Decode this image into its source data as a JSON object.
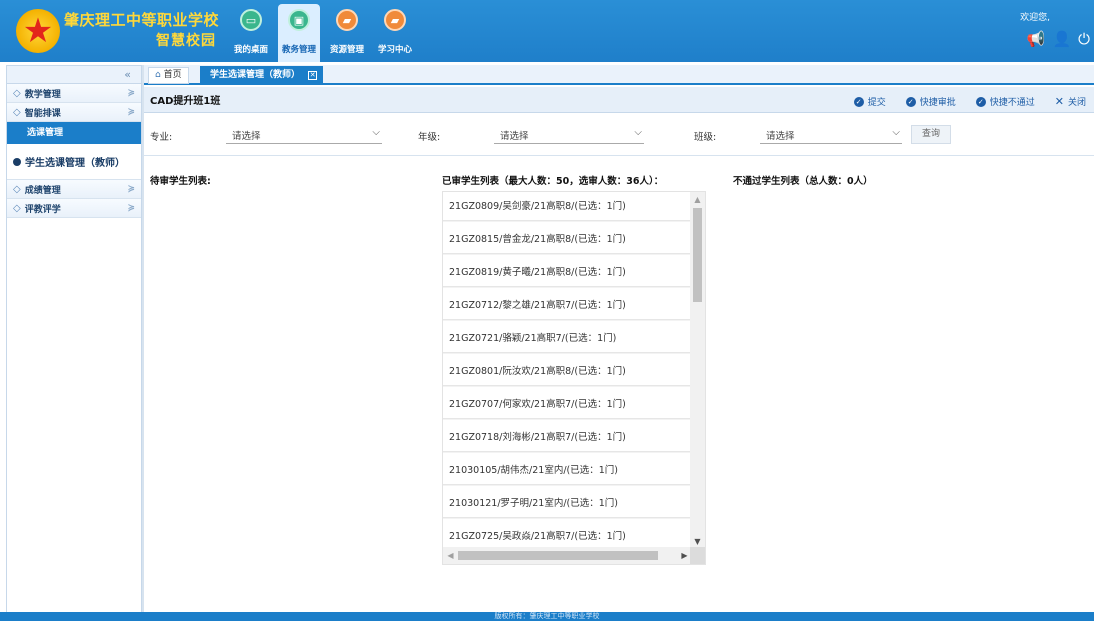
{
  "header": {
    "school_name": "肇庆理工中等职业学校",
    "campus_name": "智慧校园",
    "welcome": "欢迎您,",
    "nav": [
      {
        "label": "我的桌面",
        "icon": "desktop-icon",
        "active": false
      },
      {
        "label": "教务管理",
        "icon": "academic-icon",
        "active": true
      },
      {
        "label": "资源管理",
        "icon": "folder-icon",
        "active": false
      },
      {
        "label": "学习中心",
        "icon": "folder-icon",
        "active": false
      }
    ]
  },
  "sidebar": {
    "groups": [
      {
        "label": "教学管理"
      },
      {
        "label": "智能排课"
      }
    ],
    "sub_active": "选课管理",
    "leaf": "学生选课管理（教师）",
    "groups_after": [
      {
        "label": "成绩管理"
      },
      {
        "label": "评教评学"
      }
    ]
  },
  "tabs": {
    "home": "首页",
    "active": "学生选课管理（教师）"
  },
  "page": {
    "title": "CAD提升班1班",
    "actions": {
      "submit": "提交",
      "quick_approve": "快捷审批",
      "quick_reject": "快捷不通过",
      "close": "关闭"
    }
  },
  "filters": {
    "major_label": "专业:",
    "major_value": "请选择",
    "grade_label": "年级:",
    "grade_value": "请选择",
    "class_label": "班级:",
    "class_value": "请选择",
    "query": "查询"
  },
  "columns": {
    "pending": "待审学生列表:",
    "approved": "已审学生列表（最大人数：50，选审人数：36人）：",
    "rejected": "不通过学生列表（总人数：0人）"
  },
  "approved_list": [
    "21GZ0809/吴剑豪/21高职8/(已选：1门)",
    "21GZ0815/曾金龙/21高职8/(已选：1门)",
    "21GZ0819/黄子曦/21高职8/(已选：1门)",
    "21GZ0712/黎之雄/21高职7/(已选：1门)",
    "21GZ0721/骆颖/21高职7/(已选：1门)",
    "21GZ0801/阮汝欢/21高职8/(已选：1门)",
    "21GZ0707/何家欢/21高职7/(已选：1门)",
    "21GZ0718/刘海彬/21高职7/(已选：1门)",
    "21030105/胡伟杰/21室内/(已选：1门)",
    "21030121/罗子明/21室内/(已选：1门)",
    "21GZ0725/吴政焱/21高职7/(已选：1门)"
  ],
  "footer": "版权所有：肇庆理工中等职业学校"
}
